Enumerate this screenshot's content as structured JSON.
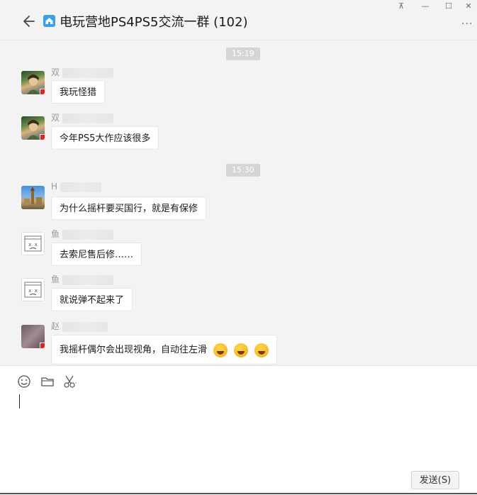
{
  "window": {
    "title": "电玩营地PS4PS5交流一群 (102)",
    "controls": [
      "⊼",
      "—",
      "☐",
      "✕"
    ]
  },
  "timestamps": [
    "15:19",
    "15:30"
  ],
  "messages": [
    {
      "sender_initial": "双",
      "text": "我玩怪猎",
      "avatar": "game-character"
    },
    {
      "sender_initial": "双",
      "text": "今年PS5大作应该很多",
      "avatar": "game-character"
    },
    {
      "sender_initial": "H",
      "text": "为什么摇杆要买国行，就是有保修",
      "avatar": "city-scene"
    },
    {
      "sender_initial": "鱼",
      "text": "去索尼售后修……",
      "avatar": "broken-image"
    },
    {
      "sender_initial": "鱼",
      "text": "就说弹不起来了",
      "avatar": "broken-image"
    },
    {
      "sender_initial": "赵",
      "text": "我摇杆偶尔会出现视角，自动往左滑",
      "avatar": "blurred",
      "emoji_count": 3
    }
  ],
  "composer": {
    "send_label": "发送(S)",
    "tools": [
      "emoji-icon",
      "folder-icon",
      "scissors-icon"
    ]
  }
}
